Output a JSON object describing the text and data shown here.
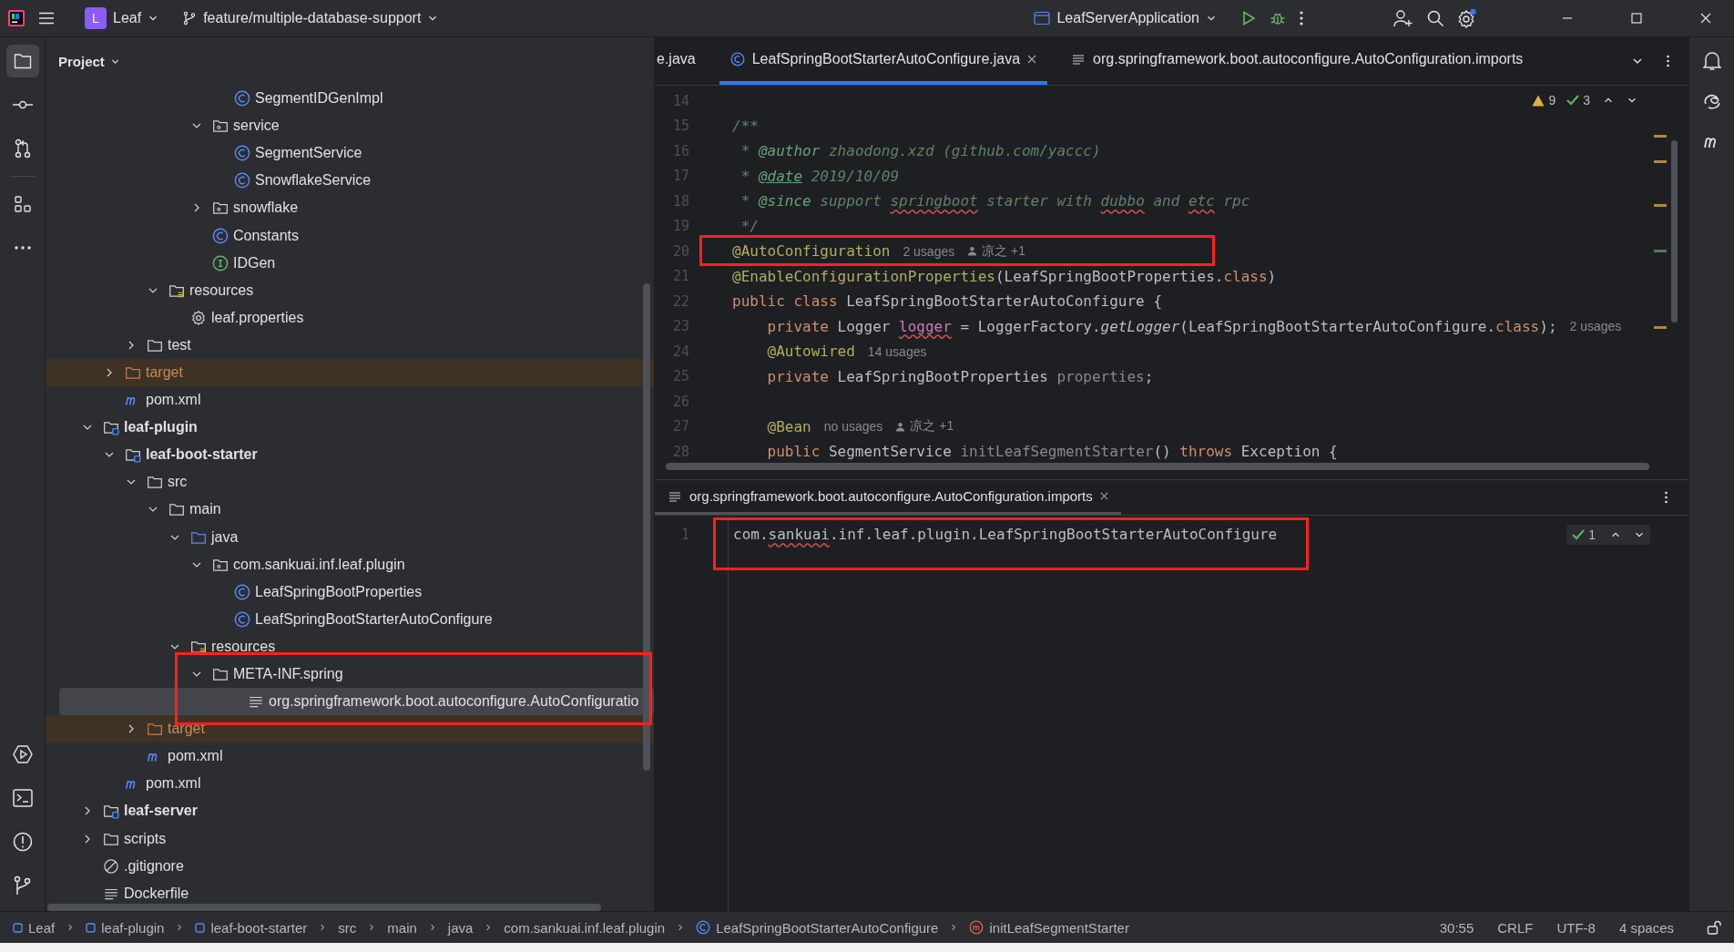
{
  "title_bar": {
    "project": {
      "badge": "L",
      "name": "Leaf"
    },
    "branch": "feature/multiple-database-support",
    "run_config": "LeafServerApplication"
  },
  "left_tools": [
    {
      "kind": "project",
      "selected": true
    },
    {
      "kind": "commit",
      "selected": false
    },
    {
      "kind": "pull-requests",
      "selected": false
    },
    {
      "kind": "structure",
      "selected": false
    },
    {
      "kind": "more",
      "selected": false
    }
  ],
  "left_tools_bottom": [
    {
      "kind": "run"
    },
    {
      "kind": "terminal"
    },
    {
      "kind": "problems"
    },
    {
      "kind": "git"
    }
  ],
  "right_tools": [
    {
      "kind": "notifications"
    },
    {
      "kind": "assistant"
    },
    {
      "kind": "maven"
    }
  ],
  "project_panel": {
    "title": "Project",
    "tree": [
      {
        "children": [
          {
            "children": [
              {
                "children": [
                  {
                    "children": [
                      {
                        "children": [
                          {
                            "children": [
                              {
                                "label": "SegmentIDGenImpl",
                                "kind": "class",
                                "selected": false
                              }
                            ]
                          },
                          {
                            "label": "service",
                            "kind": "package",
                            "expanded": true,
                            "selected": false,
                            "children": [
                              {
                                "label": "SegmentService",
                                "kind": "class",
                                "selected": false
                              },
                              {
                                "label": "SnowflakeService",
                                "kind": "class",
                                "selected": false
                              }
                            ]
                          },
                          {
                            "label": "snowflake",
                            "kind": "package",
                            "expanded": false,
                            "selected": false
                          },
                          {
                            "label": "Constants",
                            "kind": "class",
                            "selected": false
                          },
                          {
                            "label": "IDGen",
                            "kind": "interface",
                            "selected": false
                          }
                        ]
                      }
                    ]
                  },
                  {
                    "label": "resources",
                    "kind": "resources",
                    "expanded": true,
                    "selected": false,
                    "children": [
                      {
                        "label": "leaf.properties",
                        "kind": "settings",
                        "selected": false
                      }
                    ]
                  }
                ]
              },
              {
                "label": "test",
                "kind": "folder",
                "expanded": false,
                "selected": false
              }
            ]
          },
          {
            "label": "target",
            "kind": "excluded",
            "expanded": false,
            "selected": false
          },
          {
            "label": "pom.xml",
            "kind": "maven",
            "selected": false
          }
        ]
      },
      {
        "label": "leaf-plugin",
        "kind": "module",
        "expanded": true,
        "selected": false,
        "children": [
          {
            "label": "leaf-boot-starter",
            "kind": "module",
            "expanded": true,
            "selected": false,
            "children": [
              {
                "label": "src",
                "kind": "folder",
                "expanded": true,
                "selected": false,
                "children": [
                  {
                    "label": "main",
                    "kind": "folder",
                    "expanded": true,
                    "selected": false,
                    "children": [
                      {
                        "label": "java",
                        "kind": "source",
                        "expanded": true,
                        "selected": false,
                        "children": [
                          {
                            "label": "com.sankuai.inf.leaf.plugin",
                            "kind": "package",
                            "expanded": true,
                            "selected": false,
                            "children": [
                              {
                                "label": "LeafSpringBootProperties",
                                "kind": "class",
                                "selected": false
                              },
                              {
                                "label": "LeafSpringBootStarterAutoConfigure",
                                "kind": "class",
                                "selected": false
                              }
                            ]
                          }
                        ]
                      },
                      {
                        "label": "resources",
                        "kind": "resources",
                        "expanded": true,
                        "selected": false,
                        "children": [
                          {
                            "label": "META-INF.spring",
                            "kind": "folder",
                            "expanded": true,
                            "selected": false,
                            "children": [
                              {
                                "label": "org.springframework.boot.autoconfigure.AutoConfiguratio",
                                "kind": "text",
                                "selected": true
                              }
                            ]
                          }
                        ]
                      }
                    ]
                  }
                ]
              },
              {
                "label": "target",
                "kind": "excluded",
                "expanded": false,
                "selected": false
              },
              {
                "label": "pom.xml",
                "kind": "maven",
                "selected": false
              }
            ]
          },
          {
            "label": "pom.xml",
            "kind": "maven",
            "selected": false
          }
        ]
      },
      {
        "label": "leaf-server",
        "kind": "module",
        "expanded": false,
        "selected": false
      },
      {
        "label": "scripts",
        "kind": "folder",
        "expanded": false,
        "selected": false
      },
      {
        "label": ".gitignore",
        "kind": "ignore",
        "selected": false
      },
      {
        "label": "Dockerfile",
        "kind": "text",
        "selected": false
      }
    ]
  },
  "editor_tabs": [
    {
      "label": "e.java",
      "kind": "none",
      "selected": false,
      "closable": false
    },
    {
      "label": "LeafSpringBootStarterAutoConfigure.java",
      "kind": "class",
      "selected": true,
      "closable": true
    },
    {
      "label": "org.springframework.boot.autoconfigure.AutoConfiguration.imports",
      "kind": "text",
      "selected": false,
      "closable": false
    }
  ],
  "editor": {
    "inspections": {
      "warnings": "9",
      "ok": "3"
    },
    "lines": [
      {
        "number": "14"
      },
      {
        "number": "15",
        "tokens": [
          {
            "text": "/**",
            "kind": "comment"
          }
        ]
      },
      {
        "number": "16",
        "tokens": [
          {
            "text": " * ",
            "kind": "comment"
          },
          {
            "text": "@author",
            "kind": "doctag"
          },
          {
            "text": " zhaodong.xzd (github.com/yaccc)",
            "kind": "comment"
          }
        ]
      },
      {
        "number": "17",
        "tokens": [
          {
            "text": " * ",
            "kind": "comment"
          },
          {
            "text": "@date",
            "kind": "doctag-link"
          },
          {
            "text": " 2019/10/09",
            "kind": "comment"
          }
        ]
      },
      {
        "number": "18",
        "tokens": [
          {
            "text": " * ",
            "kind": "comment"
          },
          {
            "text": "@since",
            "kind": "doctag"
          },
          {
            "text": " support ",
            "kind": "comment"
          },
          {
            "text": "springboot",
            "kind": "comment-typo"
          },
          {
            "text": " starter with ",
            "kind": "comment"
          },
          {
            "text": "dubbo",
            "kind": "comment-typo"
          },
          {
            "text": " and ",
            "kind": "comment"
          },
          {
            "text": "etc",
            "kind": "comment-typo"
          },
          {
            "text": " rpc",
            "kind": "comment"
          }
        ]
      },
      {
        "number": "19",
        "tokens": [
          {
            "text": " */",
            "kind": "comment"
          }
        ]
      },
      {
        "number": "20",
        "tokens": [
          {
            "text": "@AutoConfiguration",
            "kind": "annotation"
          }
        ],
        "hints": [
          {
            "kind": "usages",
            "text": "2 usages"
          },
          {
            "kind": "author",
            "text": "凉之 +1"
          }
        ]
      },
      {
        "number": "21",
        "tokens": [
          {
            "text": "@EnableConfigurationProperties",
            "kind": "annotation"
          },
          {
            "text": "(LeafSpringBootProperties.",
            "kind": "plain"
          },
          {
            "text": "class",
            "kind": "keyword"
          },
          {
            "text": ")",
            "kind": "plain"
          }
        ]
      },
      {
        "number": "22",
        "tokens": [
          {
            "text": "public class ",
            "kind": "keyword"
          },
          {
            "text": "LeafSpringBootStarterAutoConfigure {",
            "kind": "plain"
          }
        ]
      },
      {
        "number": "23",
        "tokens": [
          {
            "text": "    private ",
            "kind": "keyword"
          },
          {
            "text": "Logger ",
            "kind": "plain"
          },
          {
            "text": "logger",
            "kind": "field-typo"
          },
          {
            "text": " = LoggerFactory.",
            "kind": "plain"
          },
          {
            "text": "getLogger",
            "kind": "static-call"
          },
          {
            "text": "(LeafSpringBootStarterAutoConfigure.",
            "kind": "plain"
          },
          {
            "text": "class",
            "kind": "keyword"
          },
          {
            "text": ");",
            "kind": "plain"
          }
        ],
        "hints": [
          {
            "kind": "usages",
            "text": "2 usages"
          }
        ]
      },
      {
        "number": "24",
        "tokens": [
          {
            "text": "    @Autowired",
            "kind": "annotation"
          }
        ],
        "hints": [
          {
            "kind": "usages",
            "text": "14 usages"
          }
        ]
      },
      {
        "number": "25",
        "tokens": [
          {
            "text": "    private ",
            "kind": "keyword"
          },
          {
            "text": "LeafSpringBootProperties ",
            "kind": "plain"
          },
          {
            "text": "properties",
            "kind": "unused"
          },
          {
            "text": ";",
            "kind": "plain"
          }
        ]
      },
      {
        "number": "26"
      },
      {
        "number": "27",
        "tokens": [
          {
            "text": "    @Bean",
            "kind": "annotation"
          }
        ],
        "hints": [
          {
            "kind": "usages",
            "text": "no usages"
          },
          {
            "kind": "author",
            "text": "凉之 +1"
          }
        ]
      },
      {
        "number": "28",
        "tokens": [
          {
            "text": "    public ",
            "kind": "keyword"
          },
          {
            "text": "SegmentService ",
            "kind": "plain"
          },
          {
            "text": "initLeafSegmentStarter",
            "kind": "unused"
          },
          {
            "text": "() ",
            "kind": "plain"
          },
          {
            "text": "throws",
            "kind": "keyword"
          },
          {
            "text": " Exception {",
            "kind": "plain"
          }
        ]
      }
    ]
  },
  "lower_editor": {
    "tab": {
      "label": "org.springframework.boot.autoconfigure.AutoConfiguration.imports",
      "kind": "text"
    },
    "inspections": {
      "ok": "1"
    },
    "lines": [
      {
        "number": "1",
        "tokens": [
          {
            "text": "com.",
            "kind": "plain"
          },
          {
            "text": "sankuai",
            "kind": "plain-typo"
          },
          {
            "text": ".inf.leaf.plugin.LeafSpringBootStarterAutoConfigure",
            "kind": "plain"
          }
        ]
      }
    ]
  },
  "status_bar": {
    "breadcrumbs": [
      {
        "label": "Leaf",
        "kind": "module"
      },
      {
        "label": "leaf-plugin",
        "kind": "module"
      },
      {
        "label": "leaf-boot-starter",
        "kind": "module"
      },
      {
        "label": "src",
        "kind": "none"
      },
      {
        "label": "main",
        "kind": "none"
      },
      {
        "label": "java",
        "kind": "none"
      },
      {
        "label": "com.sankuai.inf.leaf.plugin",
        "kind": "none"
      },
      {
        "label": "LeafSpringBootStarterAutoConfigure",
        "kind": "class"
      },
      {
        "label": "initLeafSegmentStarter",
        "kind": "method"
      }
    ],
    "items": [
      "30:55",
      "CRLF",
      "UTF-8",
      "4 spaces"
    ]
  }
}
